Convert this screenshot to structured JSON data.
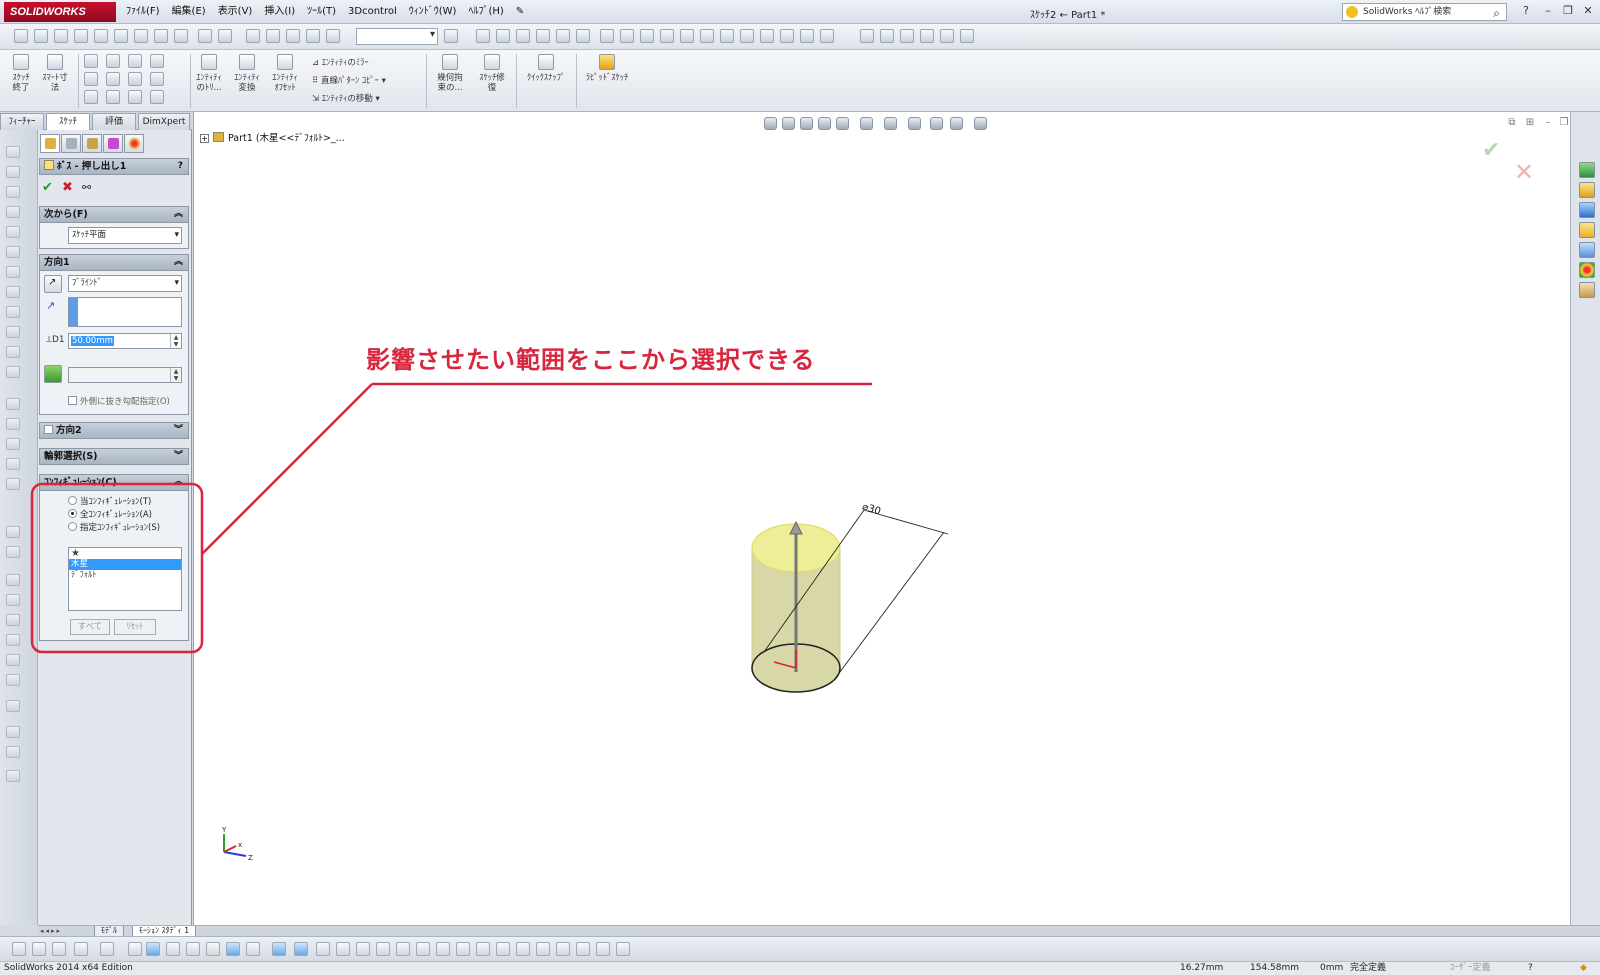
{
  "app": {
    "logo": "SOLIDWORKS",
    "title": "ｽｹｯﾁ2 ← Part1 *",
    "help_search_placeholder": "SolidWorks ﾍﾙﾌﾟ検索"
  },
  "menu": [
    "ﾌｧｲﾙ(F)",
    "編集(E)",
    "表示(V)",
    "挿入(I)",
    "ﾂｰﾙ(T)",
    "3Dcontrol",
    "ｳｨﾝﾄﾞｳ(W)",
    "ﾍﾙﾌﾟ(H)"
  ],
  "ribbon": {
    "exit_sketch": "ｽｹｯﾁ\n終了",
    "smart_dim": "ｽﾏｰﾄ寸\n法",
    "trim": "ｴﾝﾃｨﾃｨ\nのﾄﾘ...",
    "convert": "ｴﾝﾃｨﾃｨ\n変換",
    "offset": "ｴﾝﾃｨﾃｨ\nｵﾌｾｯﾄ",
    "mirror": "ｴﾝﾃｨﾃｨのﾐﾗｰ",
    "linear_pattern": "直線ﾊﾟﾀｰﾝ ｺﾋﾟｰ",
    "move": "ｴﾝﾃｨﾃｨの移動",
    "relations": "幾何拘\n束の...",
    "repair": "ｽｹｯﾁ修\n復",
    "quick_snap": "ｸｲｯｸｽﾅｯﾌﾟ",
    "rapid_sketch": "ﾗﾋﾟｯﾄﾞｽｹｯﾁ"
  },
  "cm_tabs": [
    "ﾌｨｰﾁｬｰ",
    "ｽｹｯﾁ",
    "評価",
    "DimXpert"
  ],
  "property_manager": {
    "title": "ﾎﾞｽ - 押し出し1",
    "help": "?",
    "from": {
      "header": "次から(F)",
      "value": "ｽｹｯﾁ平面"
    },
    "direction1": {
      "header": "方向1",
      "end_condition": "ﾌﾞﾗｲﾝﾄﾞ",
      "depth": "50.00mm",
      "draft_label": "外側に抜き勾配指定(O)"
    },
    "direction2": {
      "header": "方向2"
    },
    "contours": {
      "header": "輪郭選択(S)"
    },
    "configurations": {
      "header": "ｺﾝﾌｨｷﾞｭﾚｰｼｮﾝ(C)",
      "radio_this": "当ｺﾝﾌｨｷﾞｭﾚｰｼｮﾝ(T)",
      "radio_all": "全ｺﾝﾌｨｷﾞｭﾚｰｼｮﾝ(A)",
      "radio_specify": "指定ｺﾝﾌｨｷﾞｭﾚｰｼｮﾝ(S)",
      "list": [
        "★",
        "木星",
        "ﾃﾞﾌｫﾙﾄ"
      ],
      "selected_index": 1,
      "btn_all": "すべて",
      "btn_reset": "ﾘｾｯﾄ"
    }
  },
  "graphics": {
    "tree_root": "Part1  (木星<<ﾃﾞﾌｫﾙﾄ>_...",
    "dimension": "⌀30",
    "annotation": "影響させたい範囲をここから選択できる",
    "axis_x": "x",
    "axis_y": "Y",
    "axis_z": "Z"
  },
  "bottom_tabs": [
    "ﾓﾃﾞﾙ",
    "ﾓｰｼｮﾝ ｽﾀﾃﾞｨ 1"
  ],
  "status": {
    "edition": "SolidWorks 2014 x64 Edition",
    "x": "16.27mm",
    "y": "154.58mm",
    "z": "0mm",
    "state": "完全定義",
    "units": "ﾕｰｻﾞｰ定義"
  },
  "colors": {
    "accent_red": "#d7263d",
    "cylinder_fill": "#d8d7a8",
    "cylinder_top": "#eeee99",
    "selection_blue": "#3399ff"
  }
}
